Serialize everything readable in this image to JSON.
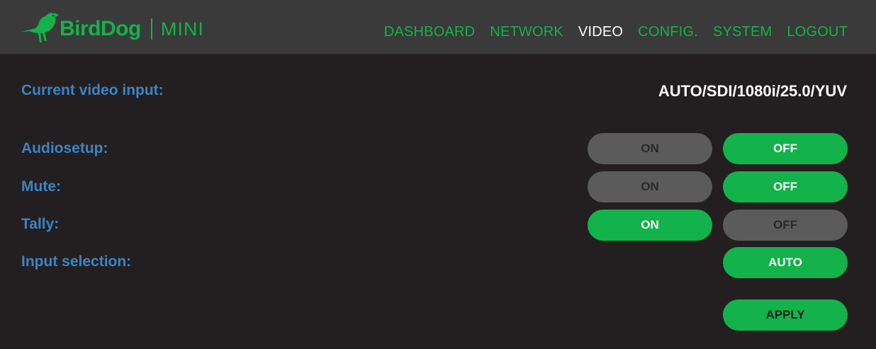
{
  "header": {
    "brand": "BirdDog",
    "product": "MINI",
    "nav": [
      {
        "label": "DASHBOARD",
        "active": false
      },
      {
        "label": "NETWORK",
        "active": false
      },
      {
        "label": "VIDEO",
        "active": true
      },
      {
        "label": "CONFIG.",
        "active": false
      },
      {
        "label": "SYSTEM",
        "active": false
      },
      {
        "label": "LOGOUT",
        "active": false
      }
    ]
  },
  "colors": {
    "accent_green": "#13b24a",
    "label_blue": "#3b84c4",
    "background": "#231f20",
    "header_bg": "#3a3a3a",
    "inactive_pill": "#5b5b5b"
  },
  "video": {
    "current_input_label": "Current video input:",
    "current_input_value": "AUTO/SDI/1080i/25.0/YUV",
    "audiosetup": {
      "label": "Audiosetup:",
      "on_label": "ON",
      "off_label": "OFF",
      "selected": "OFF"
    },
    "mute": {
      "label": "Mute:",
      "on_label": "ON",
      "off_label": "OFF",
      "selected": "OFF"
    },
    "tally": {
      "label": "Tally:",
      "on_label": "ON",
      "off_label": "OFF",
      "selected": "ON"
    },
    "input_selection": {
      "label": "Input selection:",
      "value": "AUTO"
    },
    "apply_label": "APPLY"
  }
}
